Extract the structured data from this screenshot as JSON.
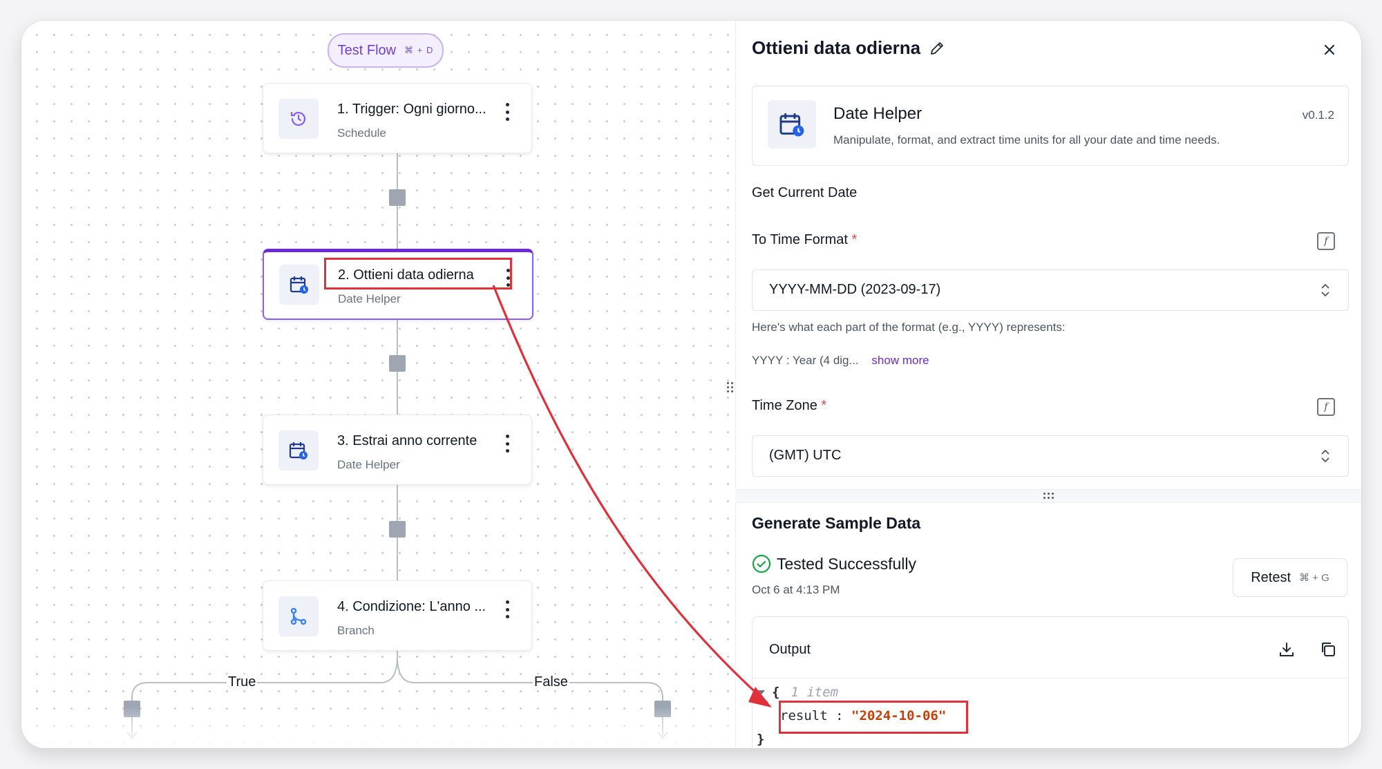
{
  "flow": {
    "test_flow": {
      "label": "Test Flow",
      "shortcut": "⌘ + D"
    },
    "nodes": [
      {
        "title": "1. Trigger: Ogni giorno...",
        "subtitle": "Schedule"
      },
      {
        "title": "2. Ottieni data odierna",
        "subtitle": "Date Helper"
      },
      {
        "title": "3. Estrai anno corrente",
        "subtitle": "Date Helper"
      },
      {
        "title": "4. Condizione: L'anno ...",
        "subtitle": "Branch"
      }
    ],
    "branches": {
      "true_label": "True",
      "false_label": "False"
    }
  },
  "panel": {
    "title": "Ottieni data odierna",
    "piece": {
      "name": "Date Helper",
      "version": "v0.1.2",
      "description": "Manipulate, format, and extract time units for all your date and time needs."
    },
    "action": "Get Current Date",
    "time_format": {
      "label": "To Time Format",
      "required_mark": "*",
      "value": "YYYY-MM-DD (2023-09-17)",
      "help": "Here's what each part of the format (e.g., YYYY) represents:",
      "preview": "YYYY : Year (4 dig...",
      "show_more": "show more"
    },
    "time_zone": {
      "label": "Time Zone",
      "required_mark": "*",
      "value": "(GMT) UTC"
    },
    "sample": {
      "heading": "Generate Sample Data",
      "status": "Tested Successfully",
      "timestamp": "Oct 6 at 4:13 PM",
      "retest": "Retest",
      "retest_shortcut": "⌘ + G"
    },
    "output": {
      "label": "Output",
      "open_brace": "{",
      "count": "1 item",
      "key": "result",
      "separator": ":",
      "value": "\"2024-10-06\"",
      "close_brace": "}"
    }
  },
  "colors": {
    "accent": "#6d28d9",
    "annotation": "#e0303a",
    "success": "#16a34a",
    "json_value": "#c2410c"
  }
}
